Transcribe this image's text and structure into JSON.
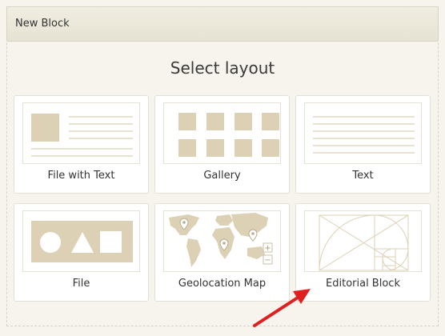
{
  "header": {
    "title": "New Block"
  },
  "page_title": "Select layout",
  "layouts": [
    {
      "label": "File with Text"
    },
    {
      "label": "Gallery"
    },
    {
      "label": "Text"
    },
    {
      "label": "File"
    },
    {
      "label": "Geolocation Map"
    },
    {
      "label": "Editorial Block"
    }
  ],
  "map_controls": {
    "zoom_in": "+",
    "zoom_out": "−"
  },
  "colors": {
    "accent": "#dcd1b5",
    "arrow": "#e02020",
    "background": "#f6f4ec"
  }
}
